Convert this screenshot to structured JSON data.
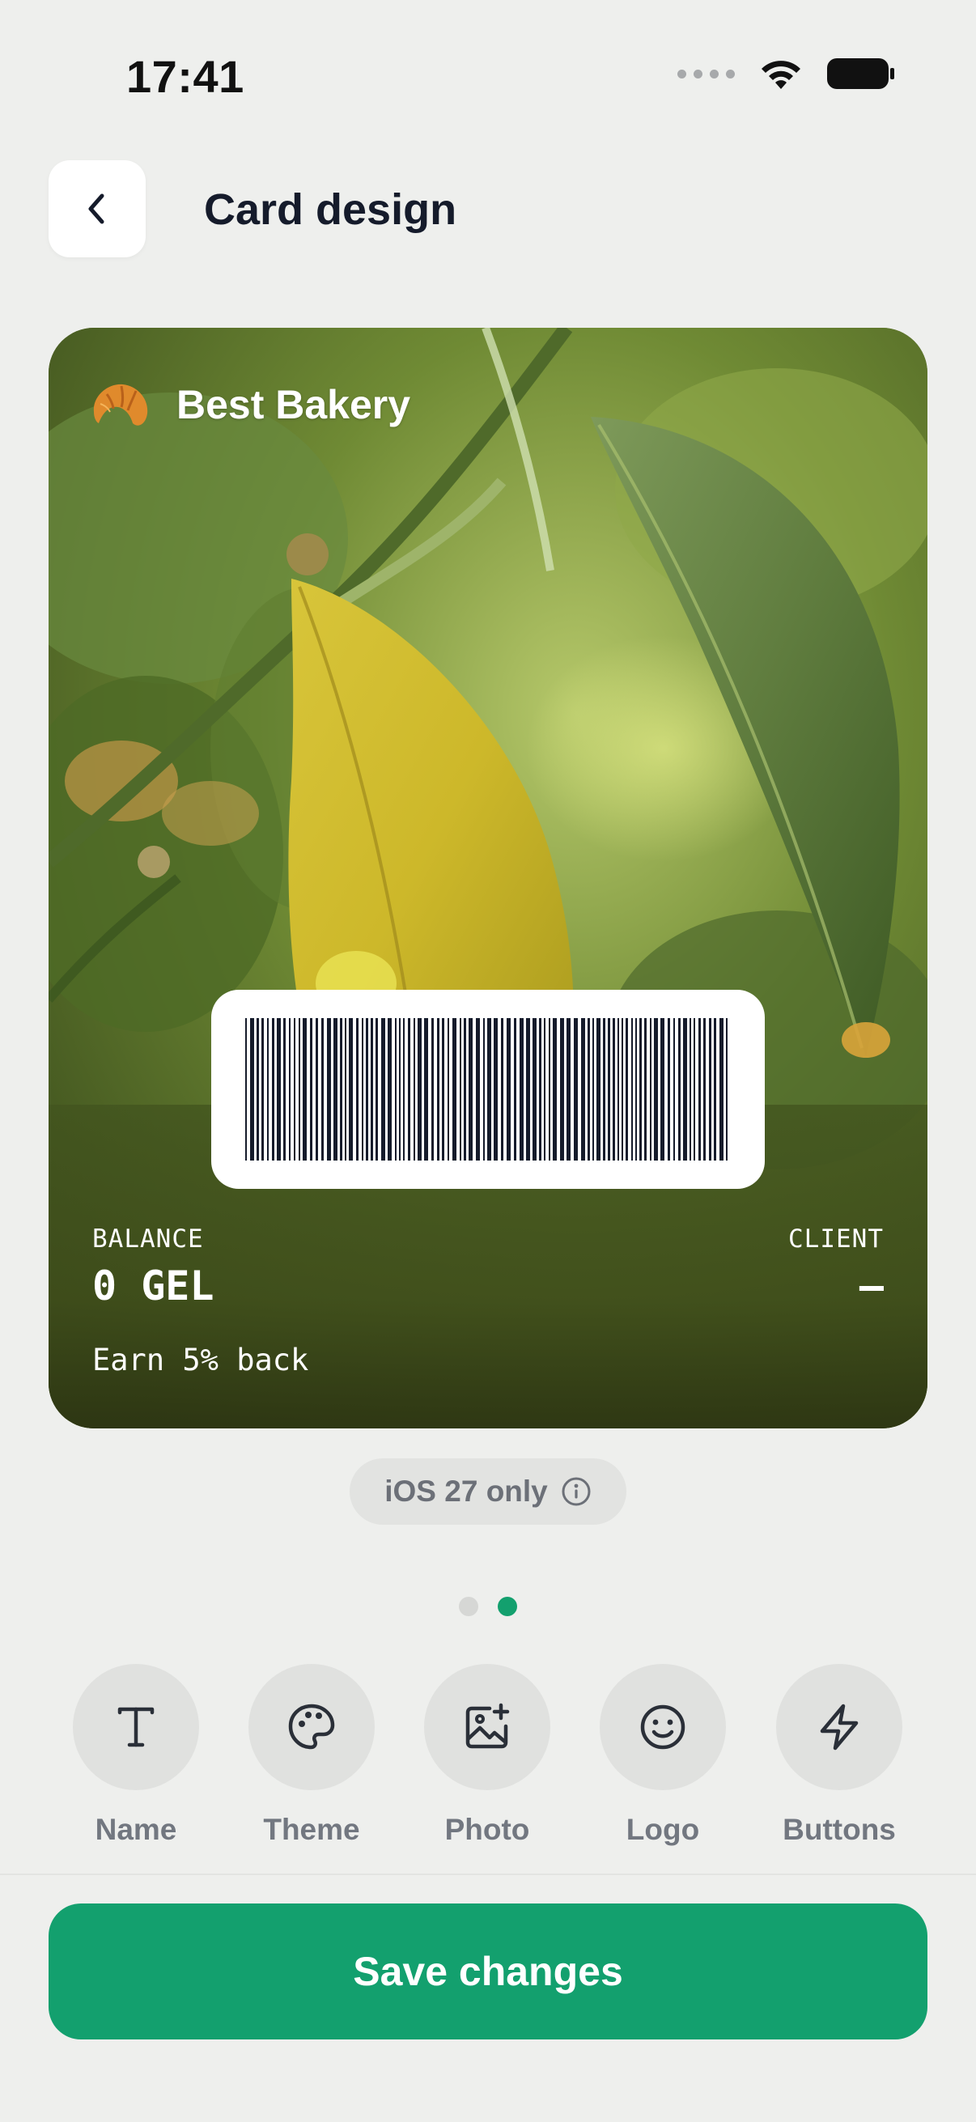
{
  "status_bar": {
    "time": "17:41"
  },
  "header": {
    "title": "Card design",
    "back_icon": "chevron-left-icon"
  },
  "card": {
    "brand_name": "Best Bakery",
    "brand_icon": "croissant-icon",
    "balance_label": "BALANCE",
    "balance_value": "0 GEL",
    "client_label": "CLIENT",
    "client_value": "—",
    "earn_text": "Earn 5% back"
  },
  "ios_pill": {
    "label": "iOS 27 only",
    "icon": "info-icon"
  },
  "pager": {
    "count": 2,
    "active_index": 1,
    "active_color": "#13a06e",
    "inactive_color": "#d6d7d5"
  },
  "toolbar": {
    "items": [
      {
        "label": "Name",
        "icon": "text-icon"
      },
      {
        "label": "Theme",
        "icon": "palette-icon"
      },
      {
        "label": "Photo",
        "icon": "image-add-icon"
      },
      {
        "label": "Logo",
        "icon": "smiley-icon"
      },
      {
        "label": "Buttons",
        "icon": "lightning-icon"
      }
    ]
  },
  "save_button": {
    "label": "Save changes",
    "color": "#13a06e"
  }
}
